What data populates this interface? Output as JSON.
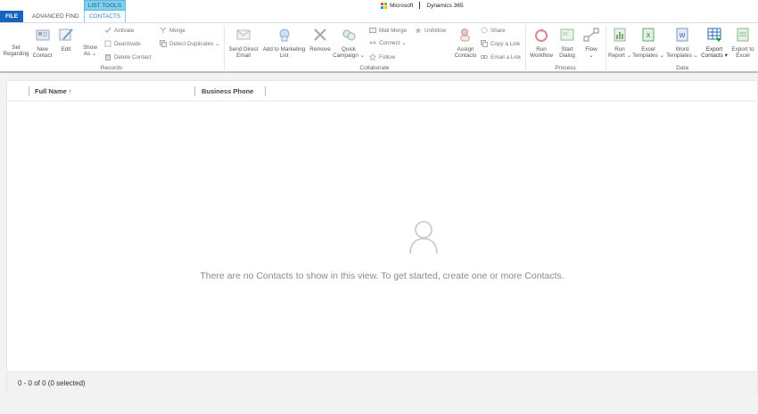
{
  "tabs": {
    "file": "FILE",
    "advanced_find": "ADVANCED FIND",
    "list_tools": "LIST TOOLS",
    "contacts": "CONTACTS"
  },
  "brand": {
    "company": "Microsoft",
    "product": "Dynamics 365"
  },
  "ribbon": {
    "records": {
      "label": "Records",
      "set_regarding": [
        "Set",
        "Regarding"
      ],
      "new_contact": [
        "New",
        "Contact"
      ],
      "edit": "Edit",
      "show_as": [
        "Show",
        "As ⌄"
      ],
      "activate": "Activate",
      "deactivate": "Deactivate",
      "delete_contact": "Delete Contact",
      "merge": "Merge",
      "detect_duplicates": "Detect Duplicates ⌄"
    },
    "collaborate": {
      "label": "Collaborate",
      "send_direct_email": [
        "Send Direct",
        "Email"
      ],
      "add_to_marketing_list": [
        "Add to Marketing",
        "List"
      ],
      "remove": "Remove",
      "quick_campaign": [
        "Quick",
        "Campaign ⌄"
      ],
      "mail_merge": "Mail Merge",
      "connect": "Connect ⌄",
      "follow": "Follow",
      "unfollow": "Unfollow",
      "assign_contacts": [
        "Assign",
        "Contacts"
      ],
      "share": "Share",
      "copy_a_link": "Copy a Link",
      "email_a_link": "Email a Link"
    },
    "process": {
      "label": "Process",
      "run_workflow": [
        "Run",
        "Workflow"
      ],
      "start_dialog": [
        "Start",
        "Dialog"
      ],
      "flow": [
        "Flow",
        "⌄"
      ]
    },
    "data": {
      "label": "Data",
      "run_report": [
        "Run",
        "Report ⌄"
      ],
      "excel_templates": [
        "Excel",
        "Templates ⌄"
      ],
      "word_templates": [
        "Word",
        "Templates ⌄"
      ],
      "export_contacts": [
        "Export",
        "Contacts ▾"
      ],
      "export_to_excel": [
        "Export to",
        "Excel"
      ]
    }
  },
  "grid": {
    "columns": [
      "Full Name ↑",
      "Business Phone"
    ],
    "empty_message": "There are no Contacts to show in this view. To get started, create one or more Contacts.",
    "status": "0 - 0 of 0 (0 selected)"
  },
  "colors": {
    "file_tab": "#1565c0",
    "list_tools": "#7fd0ef",
    "ms_red": "#f25022",
    "ms_green": "#7fba00",
    "ms_blue": "#00a4ef",
    "ms_yellow": "#ffb900"
  }
}
